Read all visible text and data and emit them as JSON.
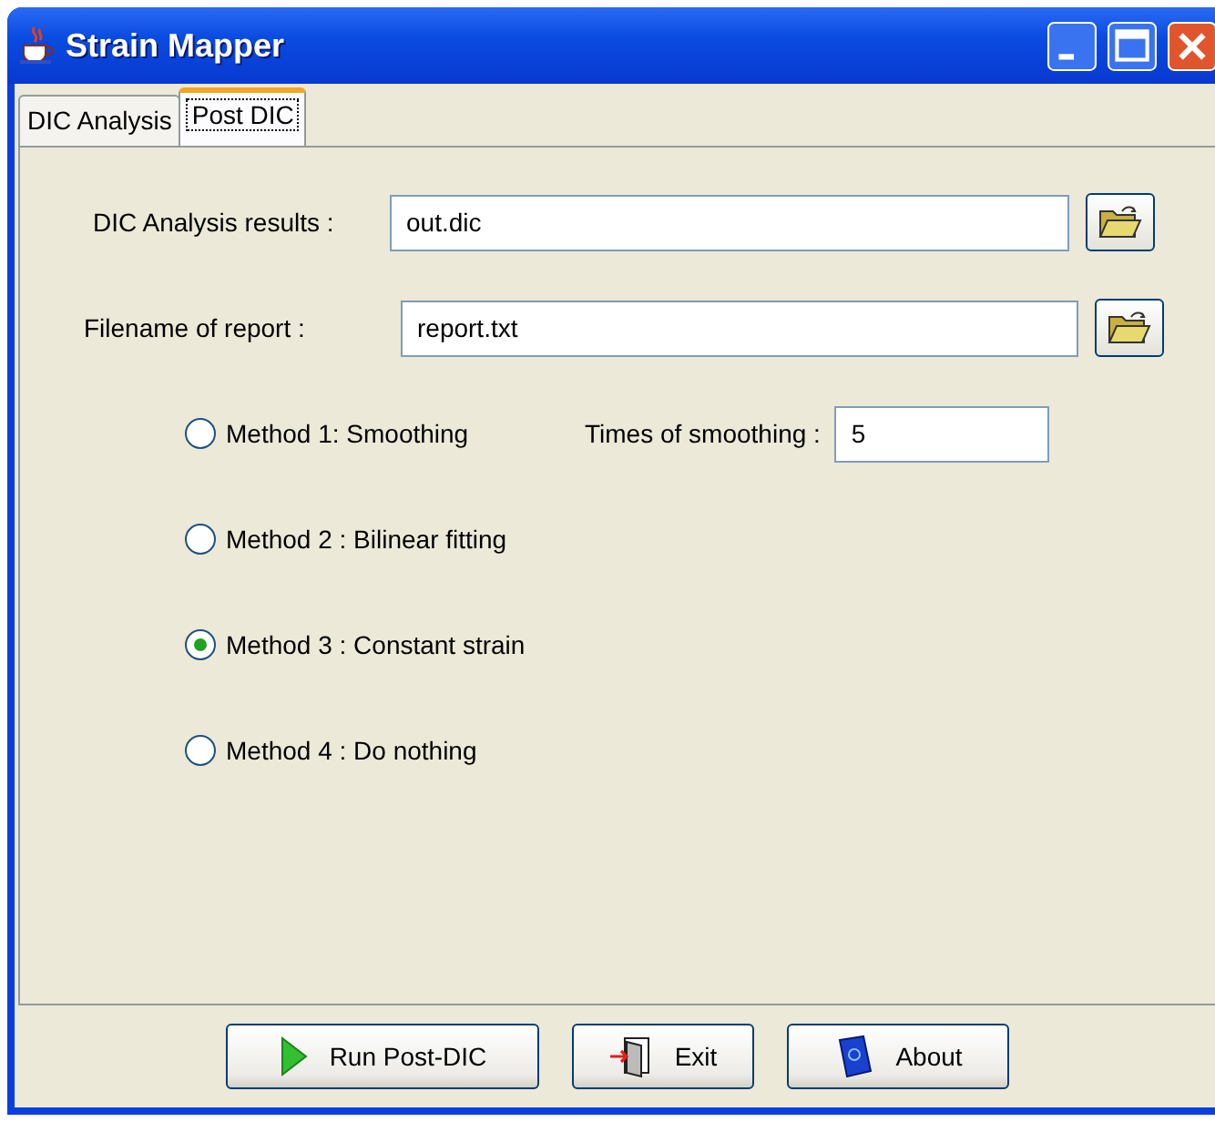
{
  "window": {
    "title": "Strain Mapper"
  },
  "tabs": [
    {
      "label": "DIC Analysis",
      "selected": false
    },
    {
      "label": "Post DIC",
      "selected": true
    }
  ],
  "file_fields": [
    {
      "label": "DIC Analysis results :",
      "value": "out.dic"
    },
    {
      "label": "Filename of report :",
      "value": "report.txt"
    }
  ],
  "methods": [
    {
      "label": "Method 1: Smoothing",
      "selected": false
    },
    {
      "label": "Method 2 : Bilinear fitting",
      "selected": false
    },
    {
      "label": "Method 3 : Constant strain",
      "selected": true
    },
    {
      "label": "Method 4 : Do nothing",
      "selected": false
    }
  ],
  "smoothing": {
    "label": "Times of smoothing :",
    "value": "5"
  },
  "buttons": [
    {
      "label": "Run Post-DIC",
      "kind": "run"
    },
    {
      "label": "Exit",
      "kind": "exit"
    },
    {
      "label": "About",
      "kind": "about"
    }
  ]
}
